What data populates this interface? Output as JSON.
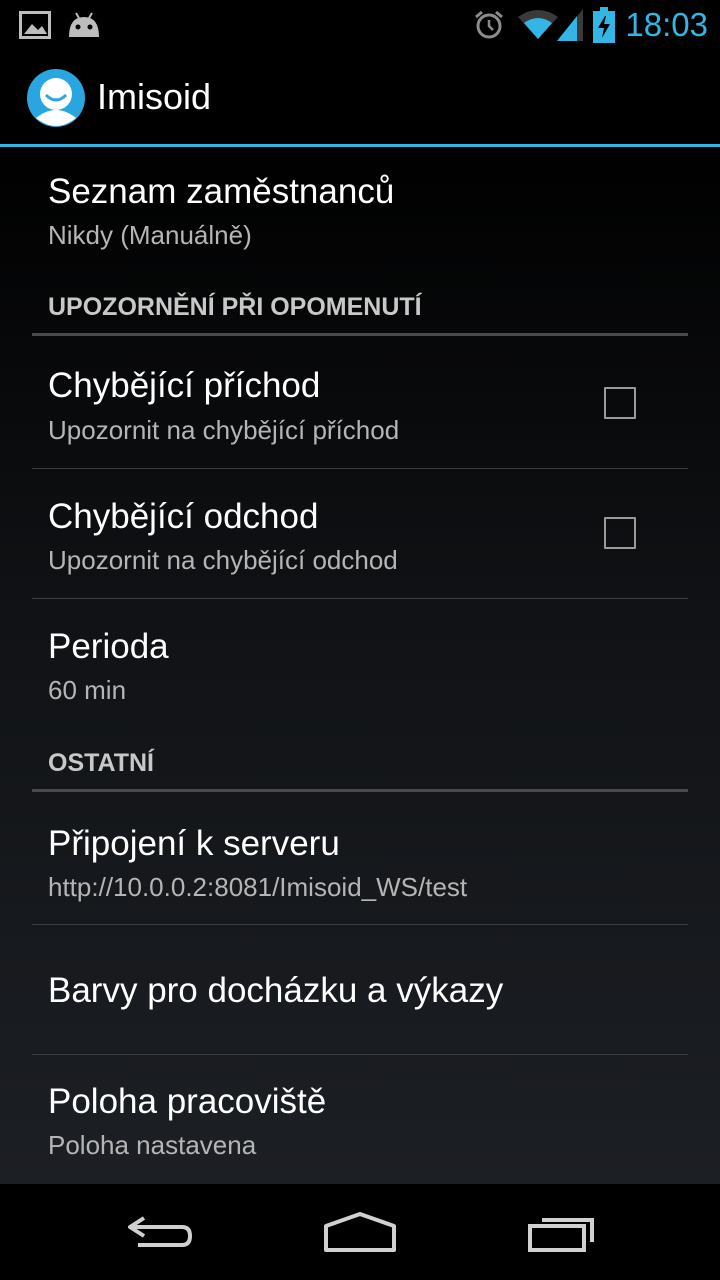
{
  "status_bar": {
    "time": "18:03",
    "left_icons": [
      "picture-icon",
      "android-icon"
    ],
    "right_icons": [
      "alarm-icon",
      "wifi-icon",
      "signal-icon",
      "battery-charging-icon"
    ],
    "accent_color": "#33b5e5"
  },
  "action_bar": {
    "title": "Imisoid",
    "icon": "app-logo-icon"
  },
  "preferences": {
    "employee_list": {
      "title": "Seznam zaměstnanců",
      "summary": "Nikdy (Manuálně)"
    },
    "category_missed": "UPOZORNĚNÍ PŘI OPOMENUTÍ",
    "missing_arrival": {
      "title": "Chybějící příchod",
      "summary": "Upozornit na chybějící příchod",
      "checked": false
    },
    "missing_departure": {
      "title": "Chybějící odchod",
      "summary": "Upozornit na chybějící odchod",
      "checked": false
    },
    "period": {
      "title": "Perioda",
      "summary": "60 min"
    },
    "category_other": "OSTATNÍ",
    "server_connection": {
      "title": "Připojení k serveru",
      "summary": "http://10.0.0.2:8081/Imisoid_WS/test"
    },
    "colors": {
      "title": "Barvy pro docházku a výkazy"
    },
    "workplace_location": {
      "title": "Poloha pracoviště",
      "summary": "Poloha nastavena"
    }
  },
  "nav_bar": {
    "buttons": [
      "back-icon",
      "home-icon",
      "recent-apps-icon"
    ]
  }
}
